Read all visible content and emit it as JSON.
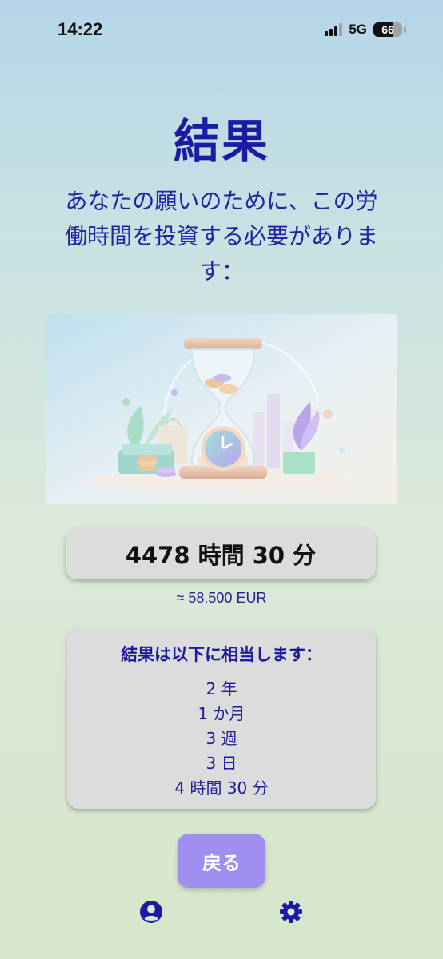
{
  "status_bar": {
    "time": "14:22",
    "network": "5G",
    "battery_level": "66"
  },
  "result": {
    "title": "結果",
    "subtitle": "あなたの願いのために、この労働時間を投資する必要があります：",
    "hours": "4478 時間 30 分",
    "eur": "≈ 58.500 EUR"
  },
  "equivalents": {
    "heading": "結果は以下に相当します：",
    "items": [
      "2 年",
      "1 か月",
      "3 週",
      "3 日",
      "4 時間 30 分"
    ]
  },
  "actions": {
    "back_label": "戻る"
  },
  "nav": {
    "profile_icon": "profile-icon",
    "settings_icon": "gear-icon"
  },
  "colors": {
    "accent": "#1b1ba3",
    "button": "#a08ef0",
    "card": "#dcdcdc"
  }
}
